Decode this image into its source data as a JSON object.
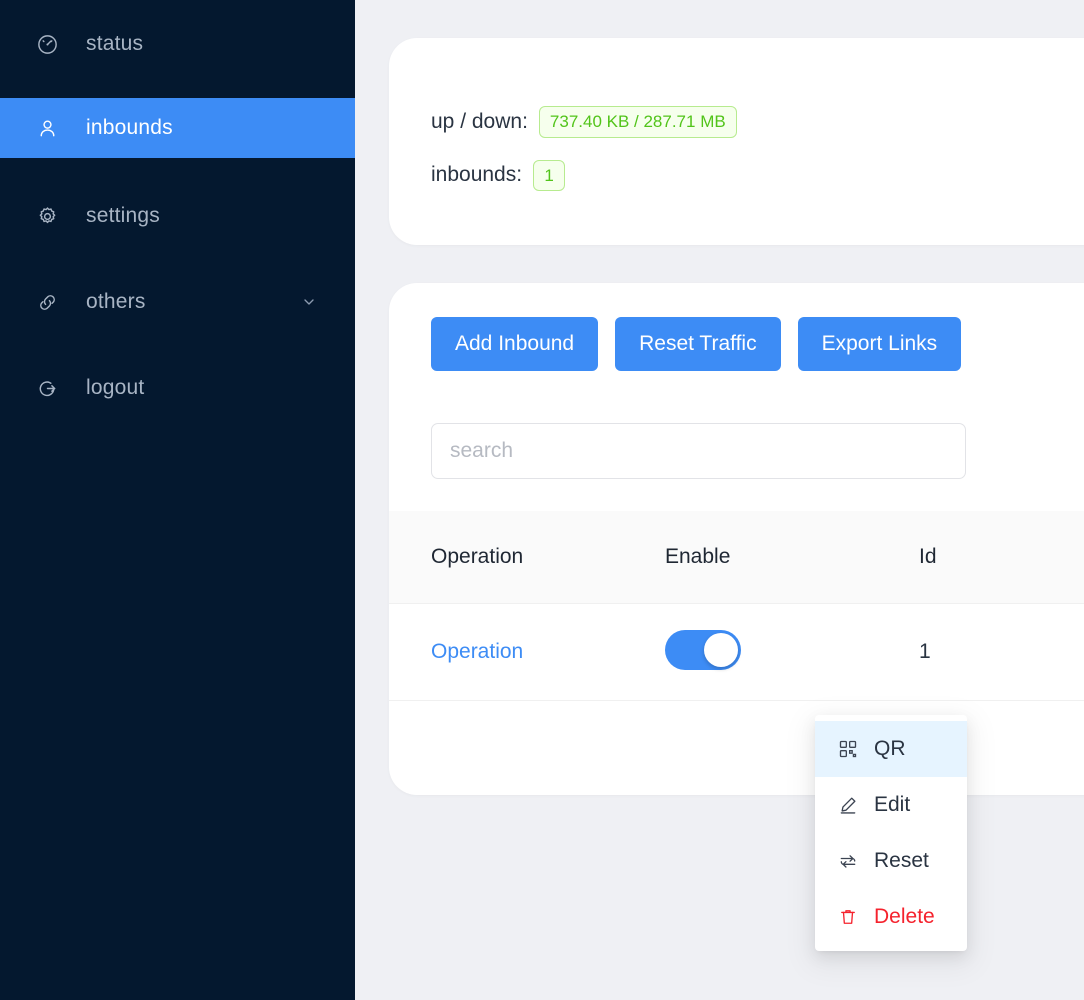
{
  "sidebar": {
    "items": [
      {
        "id": "status",
        "label": "status",
        "icon": "dashboard-icon",
        "active": false,
        "chevron": false
      },
      {
        "id": "inbounds",
        "label": "inbounds",
        "icon": "user-icon",
        "active": true,
        "chevron": false
      },
      {
        "id": "settings",
        "label": "settings",
        "icon": "gear-icon",
        "active": false,
        "chevron": false
      },
      {
        "id": "others",
        "label": "others",
        "icon": "link-icon",
        "active": false,
        "chevron": true
      },
      {
        "id": "logout",
        "label": "logout",
        "icon": "logout-icon",
        "active": false,
        "chevron": false
      }
    ],
    "background_color": "#04182f",
    "active_color": "#3d8cf5"
  },
  "stats": {
    "updown_label": "up / down:",
    "updown_value": "737.40 KB / 287.71 MB",
    "inbounds_label": "inbounds:",
    "inbounds_value": "1",
    "badge_bg": "#f6ffed",
    "badge_border": "#b7eb8f",
    "badge_text": "#52c41a"
  },
  "toolbar": {
    "add_inbound_label": "Add Inbound",
    "reset_traffic_label": "Reset Traffic",
    "export_links_label": "Export Links",
    "button_color": "#3d8cf5"
  },
  "search": {
    "placeholder": "search",
    "value": ""
  },
  "table": {
    "columns": [
      {
        "key": "operation",
        "label": "Operation"
      },
      {
        "key": "enable",
        "label": "Enable"
      },
      {
        "key": "id",
        "label": "Id"
      }
    ],
    "rows": [
      {
        "operation": "Operation",
        "enable": true,
        "id": "1"
      }
    ]
  },
  "dropdown": {
    "items": [
      {
        "label": "QR",
        "icon": "qr-code-icon",
        "hover": true,
        "danger": false
      },
      {
        "label": "Edit",
        "icon": "pencil-icon",
        "hover": false,
        "danger": false
      },
      {
        "label": "Reset",
        "icon": "reset-icon",
        "hover": false,
        "danger": false
      },
      {
        "label": "Delete",
        "icon": "trash-icon",
        "hover": false,
        "danger": true
      }
    ],
    "danger_color": "#f5222d",
    "hover_bg": "#e6f4ff"
  }
}
